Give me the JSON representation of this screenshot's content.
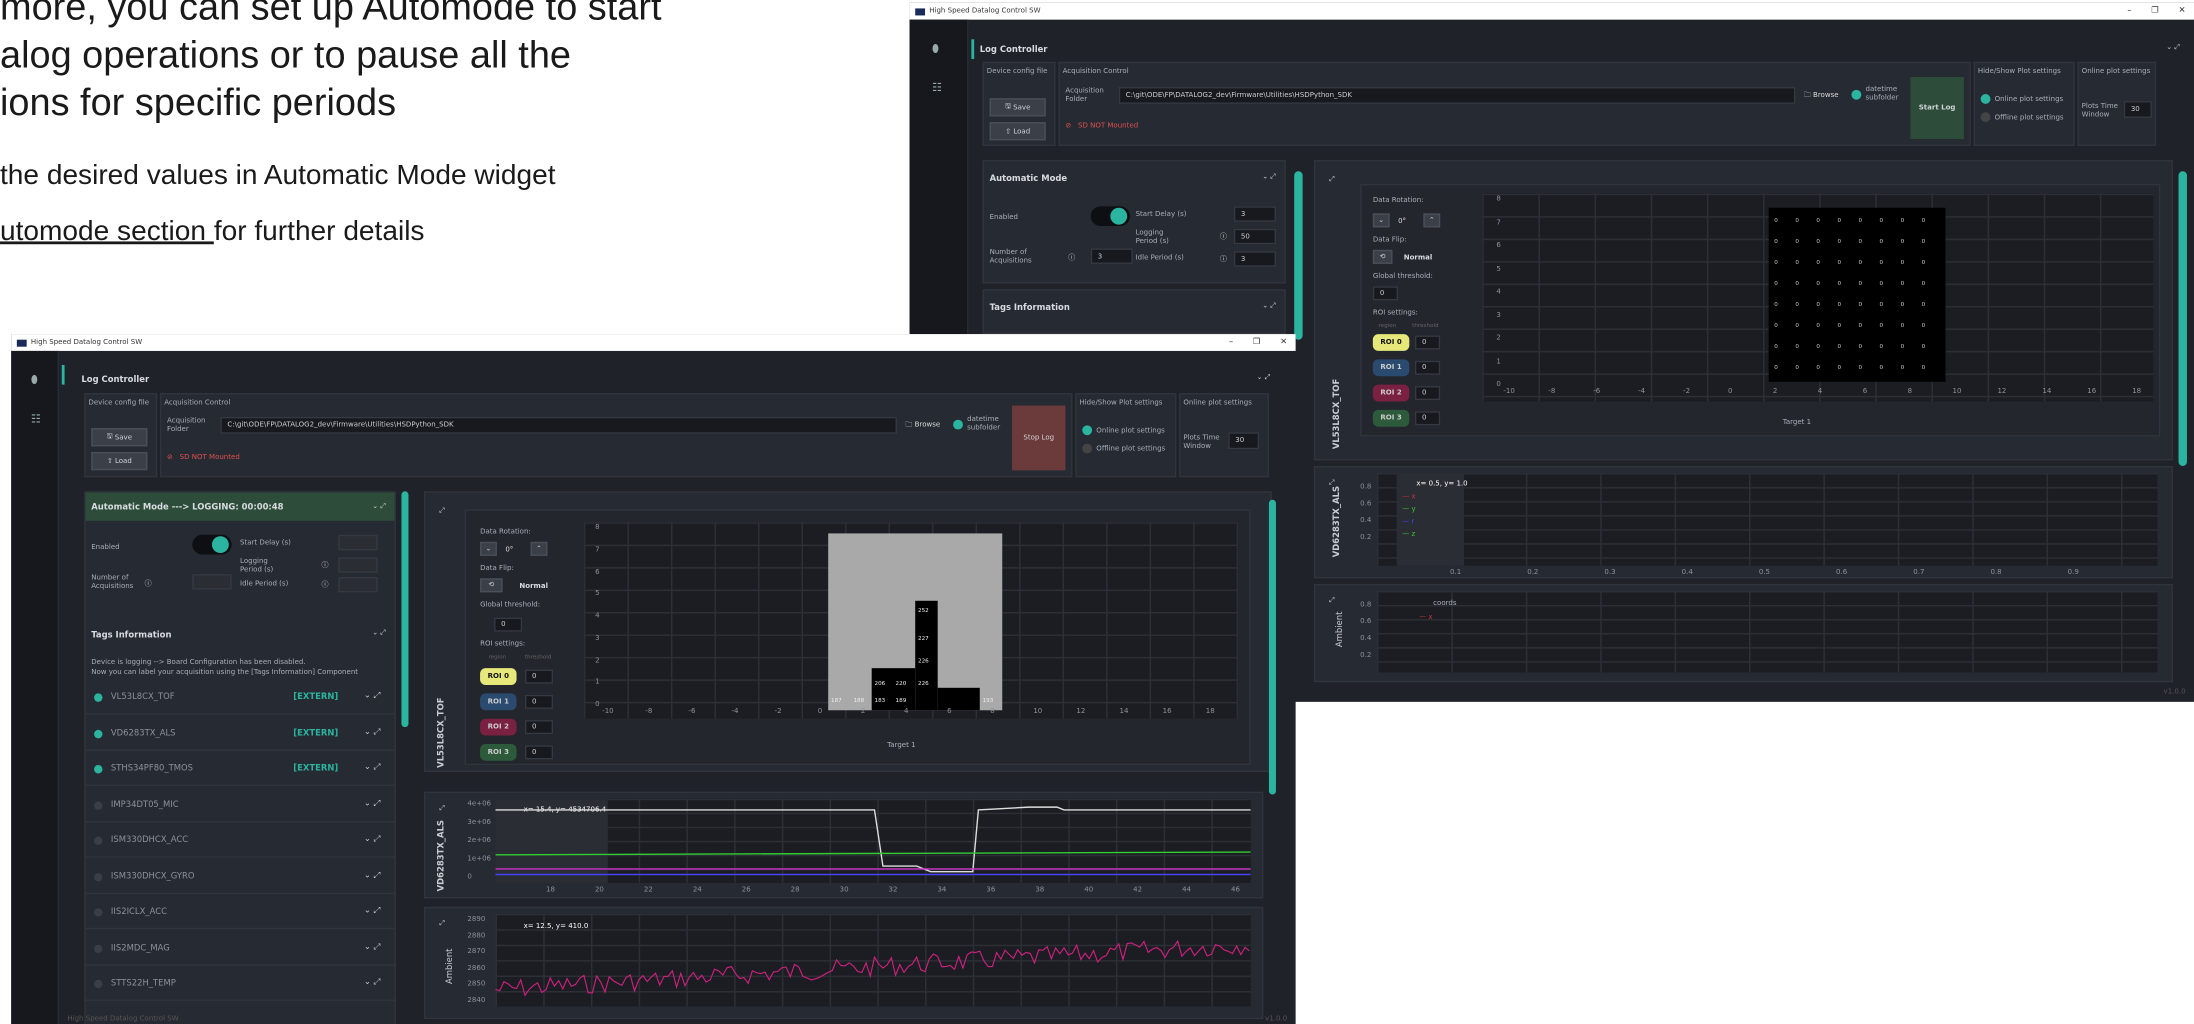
{
  "slide": {
    "line1": "more, you can set up Automode to start",
    "line2": "alog operations or to pause all the",
    "line3": "ions for specific periods",
    "bullet1": " the desired values in Automatic Mode widget",
    "bullet2_link": "utomode section ",
    "bullet2_rest": "for further details"
  },
  "common": {
    "app_title": "High Speed Datalog Control SW",
    "log_controller": "Log Controller",
    "device_config": "Device config file",
    "acq_control": "Acquisition Control",
    "save": "Save",
    "load": "Load",
    "acq_folder": "Acquisition Folder",
    "folder_path": "C:\\git\\ODE\\FP\\DATALOG2_dev\\Firmware\\Utilities\\HSDPython_SDK",
    "browse": "Browse",
    "datetime_subfolder": "datetime subfolder",
    "sd_status": "SD NOT Mounted",
    "hide_show": "Hide/Show Plot settings",
    "online_settings": "Online plot settings",
    "online_plot": "Online plot settings",
    "offline_plot": "Offline plot settings",
    "plots_time": "Plots Time Window",
    "plots_time_val": "30",
    "enabled": "Enabled",
    "start_delay": "Start Delay (s)",
    "logging_period": "Logging Period (s)",
    "num_acq": "Number of Acquisitions",
    "idle_period": "Idle Period (s)",
    "tags_info": "Tags Information",
    "data_rotation": "Data Rotation:",
    "rot_val": "0°",
    "data_flip": "Data Flip:",
    "normal": "Normal",
    "global_threshold": "Global threshold:",
    "gt_val": "0",
    "roi_settings": "ROI settings:",
    "region": "region",
    "threshold": "threshold",
    "roi0": "ROI 0",
    "roi1": "ROI 1",
    "roi2": "ROI 2",
    "roi3": "ROI 3",
    "zero": "0",
    "target": "Target 1",
    "tof_label": "VL53L8CX_TOF",
    "als_label": "VD6283TX_ALS",
    "ambient": "Ambient",
    "version": "v1.0.0"
  },
  "back_window": {
    "start_log": "Start Log",
    "start_delay_val": "3",
    "logging_period_val": "50",
    "num_acq_val": "3",
    "idle_val": "3",
    "automatic_mode": "Automatic Mode",
    "als_readout": "x= 0.5, y= 1.0",
    "amb_legend": "coords",
    "als_legend": [
      "x",
      "y",
      "r",
      "z"
    ],
    "als_xticks": [
      "0.1",
      "0.2",
      "0.3",
      "0.4",
      "0.5",
      "0.6",
      "0.7",
      "0.8",
      "0.9"
    ],
    "als_yticks": [
      "0.8",
      "0.6",
      "0.4",
      "0.2"
    ],
    "amb_yticks": [
      "0.8",
      "0.6",
      "0.4",
      "0.2"
    ],
    "amb_x": "x"
  },
  "front_window": {
    "stop_log": "Stop Log",
    "automatic_mode": "Automatic Mode ---> LOGGING: 00:00:48",
    "notice1": "Device is logging --> Board Configuration has been disabled.",
    "notice2": "Now you can label your acquisition using the [Tags Information] Component",
    "extern": "[EXTERN]",
    "tags": [
      {
        "name": "VL53L8CX_TOF",
        "active": true
      },
      {
        "name": "VD6283TX_ALS",
        "active": true
      },
      {
        "name": "STHS34PF80_TMOS",
        "active": true
      },
      {
        "name": "IMP34DT05_MIC",
        "active": false
      },
      {
        "name": "ISM330DHCX_ACC",
        "active": false
      },
      {
        "name": "ISM330DHCX_GYRO",
        "active": false
      },
      {
        "name": "IIS2ICLX_ACC",
        "active": false
      },
      {
        "name": "IIS2MDC_MAG",
        "active": false
      },
      {
        "name": "STTS22H_TEMP",
        "active": false
      }
    ],
    "als_readout": "x= 15.4, y= 4534706.4",
    "amb_readout": "x= 12.5, y= 410.0",
    "als_yticks": [
      "4e+06",
      "3e+06",
      "2e+06",
      "1e+06",
      "0"
    ],
    "als_xticks": [
      "18",
      "20",
      "22",
      "24",
      "26",
      "28",
      "30",
      "32",
      "34",
      "36",
      "38",
      "40",
      "42",
      "44",
      "46"
    ],
    "amb_yticks": [
      "2890",
      "2880",
      "2870",
      "2860",
      "2850",
      "2840"
    ],
    "tof_values": [
      "252",
      "227",
      "226",
      "206",
      "220",
      "226",
      "187",
      "188",
      "183",
      "189",
      "193"
    ]
  },
  "tof": {
    "xticks": [
      "-10",
      "-8",
      "-6",
      "-4",
      "-2",
      "0",
      "2",
      "4",
      "6",
      "8",
      "10",
      "12",
      "14",
      "16",
      "18"
    ],
    "yticks": [
      "8",
      "7",
      "6",
      "5",
      "4",
      "3",
      "2",
      "1",
      "0"
    ]
  },
  "colors": {
    "accent": "#2bb5a0",
    "stop": "#6b3a3a",
    "start": "#2d4d3a",
    "sd": "#e05050",
    "roi0": "#e6e87a",
    "roi1": "#2b4a70",
    "roi2": "#7a2040",
    "roi3": "#2d5a3a"
  }
}
